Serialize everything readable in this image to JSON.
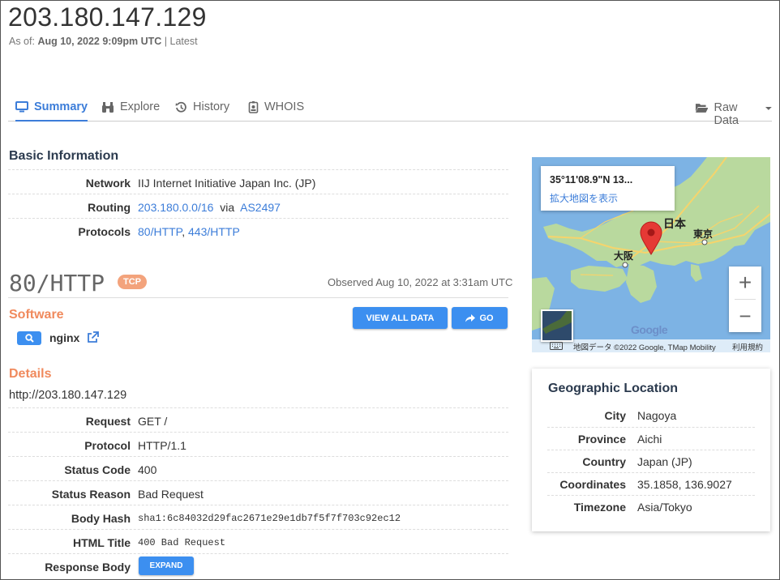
{
  "header": {
    "ip": "203.180.147.129",
    "as_of_label": "As of:",
    "as_of_date": "Aug 10, 2022 9:09pm UTC",
    "as_of_sep": "|",
    "as_of_latest": "Latest"
  },
  "tabs": [
    {
      "label": "Summary",
      "icon": "monitor-icon",
      "active": true
    },
    {
      "label": "Explore",
      "icon": "binoculars-icon",
      "active": false
    },
    {
      "label": "History",
      "icon": "history-icon",
      "active": false
    },
    {
      "label": "WHOIS",
      "icon": "id-badge-icon",
      "active": false
    }
  ],
  "raw_data": {
    "label": "Raw Data",
    "icon": "folder-open-icon"
  },
  "basic": {
    "title": "Basic Information",
    "network_label": "Network",
    "network_value": "IIJ Internet Initiative Japan Inc. (JP)",
    "routing_label": "Routing",
    "routing_prefix": "203.180.0.0/16",
    "routing_via": "via",
    "routing_as": "AS2497",
    "protocols_label": "Protocols",
    "protocol_1": "80/HTTP",
    "protocol_sep": ",",
    "protocol_2": "443/HTTP"
  },
  "service": {
    "port_title": "80/HTTP",
    "badge": "TCP",
    "observed": "Observed Aug 10, 2022 at 3:31am UTC",
    "software_title": "Software",
    "view_all_label": "VIEW ALL DATA",
    "go_label": "GO",
    "software_name": "nginx",
    "details_title": "Details",
    "url": "http://203.180.147.129",
    "details": [
      {
        "key": "Request",
        "value": "GET /"
      },
      {
        "key": "Protocol",
        "value": "HTTP/1.1"
      },
      {
        "key": "Status Code",
        "value": "400"
      },
      {
        "key": "Status Reason",
        "value": "Bad Request"
      },
      {
        "key": "Body Hash",
        "value": "sha1:6c84032d29fac2671e29e1db7f5f7f703c92ec12"
      },
      {
        "key": "HTML Title",
        "value": "400 Bad Request"
      },
      {
        "key": "Response Body",
        "value": ""
      }
    ],
    "expand_label": "EXPAND"
  },
  "map": {
    "coord_popup": "35°11'08.9\"N 13...",
    "enlarge_link": "拡大地図を表示",
    "label_japan": "日本",
    "label_osaka": "大阪",
    "label_tokyo": "東京",
    "zoom_in": "+",
    "zoom_out": "−",
    "google": "Google",
    "attribution": "地図データ ©2022 Google, TMap Mobility",
    "terms": "利用規約"
  },
  "geo": {
    "title": "Geographic Location",
    "rows": [
      {
        "key": "City",
        "value": "Nagoya"
      },
      {
        "key": "Province",
        "value": "Aichi"
      },
      {
        "key": "Country",
        "value": "Japan (JP)"
      },
      {
        "key": "Coordinates",
        "value": "35.1858, 136.9027"
      },
      {
        "key": "Timezone",
        "value": "Asia/Tokyo"
      }
    ]
  },
  "colors": {
    "accent": "#3c7dd9",
    "button": "#3c8ff0",
    "orange": "#f08a5d",
    "badge": "#f3a37c"
  }
}
